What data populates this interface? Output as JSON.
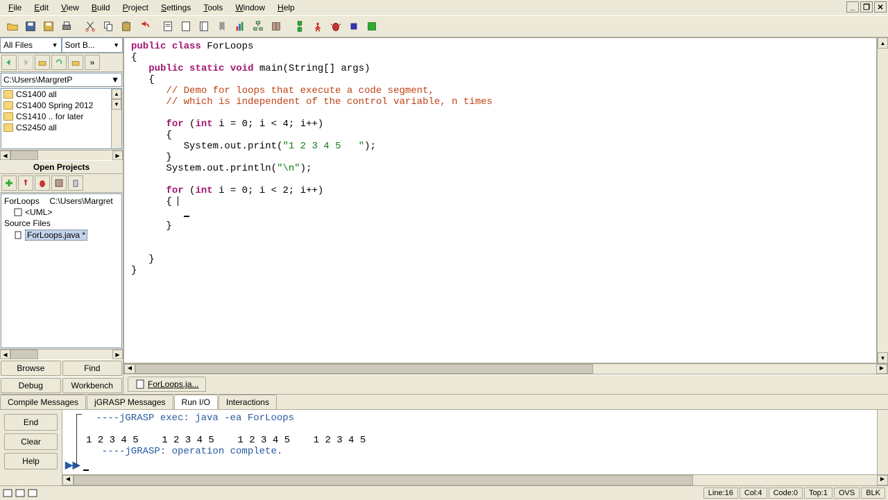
{
  "menu": {
    "file": "File",
    "edit": "Edit",
    "view": "View",
    "build": "Build",
    "project": "Project",
    "settings": "Settings",
    "tools": "Tools",
    "window": "Window",
    "help": "Help"
  },
  "window": {
    "minimize": "_",
    "restore": "❐",
    "close": "✕"
  },
  "left": {
    "filter_files": "All Files",
    "sort": "Sort B...",
    "path": "C:\\Users\\MargretP",
    "folders": [
      "CS1400 all",
      "CS1400 Spring 2012",
      "CS1410 .. for later",
      "CS2450 all"
    ],
    "open_projects": "Open Projects",
    "project_name": "ForLoops",
    "project_path": "C:\\Users\\Margret",
    "uml": "<UML>",
    "source_files": "Source Files",
    "file": "ForLoops.java *",
    "browse": "Browse",
    "find": "Find",
    "debug": "Debug",
    "workbench": "Workbench"
  },
  "editor": {
    "tab": "ForLoops.ja...",
    "code": {
      "l1_a": "public",
      "l1_b": "class",
      "l1_c": " ForLoops",
      "l2": "{",
      "l3_a": "public",
      "l3_b": "static",
      "l3_c": "void",
      "l3_d": " main(String[] args)",
      "l4": "{",
      "c1": "// Demo for loops that execute a code segment,",
      "c2": "// which is independent of the control variable, n times",
      "f1_a": "for",
      "f1_b": " (",
      "f1_c": "int",
      "f1_d": " i = 0; i < 4; i++)",
      "f1_open": "{",
      "p1_a": "System.out.print(",
      "p1_b": "\"1 2 3 4 5   \"",
      "p1_c": ");",
      "f1_close": "}",
      "pl_a": "System.out.println(",
      "pl_b": "\"\\n\"",
      "pl_c": ");",
      "f2_a": "for",
      "f2_b": " (",
      "f2_c": "int",
      "f2_d": " i = 0; i < 2; i++)",
      "f2_open": "{",
      "f2_close": "}",
      "m_close": "}",
      "cl_close": "}"
    }
  },
  "bottom_tabs": {
    "compile": "Compile Messages",
    "jgrasp": "jGRASP Messages",
    "runio": "Run I/O",
    "interact": "Interactions"
  },
  "output": {
    "end": "End",
    "clear": "Clear",
    "help": "Help",
    "exec": " ----jGRASP exec: java -ea ForLoops",
    "out": "1 2 3 4 5    1 2 3 4 5    1 2 3 4 5    1 2 3 4 5",
    "done": "  ----jGRASP: operation complete.",
    "prompt": "▶▶"
  },
  "status": {
    "line": "Line:16",
    "col": "Col:4",
    "code": "Code:0",
    "top": "Top:1",
    "ovs": "OVS",
    "blk": "BLK"
  }
}
